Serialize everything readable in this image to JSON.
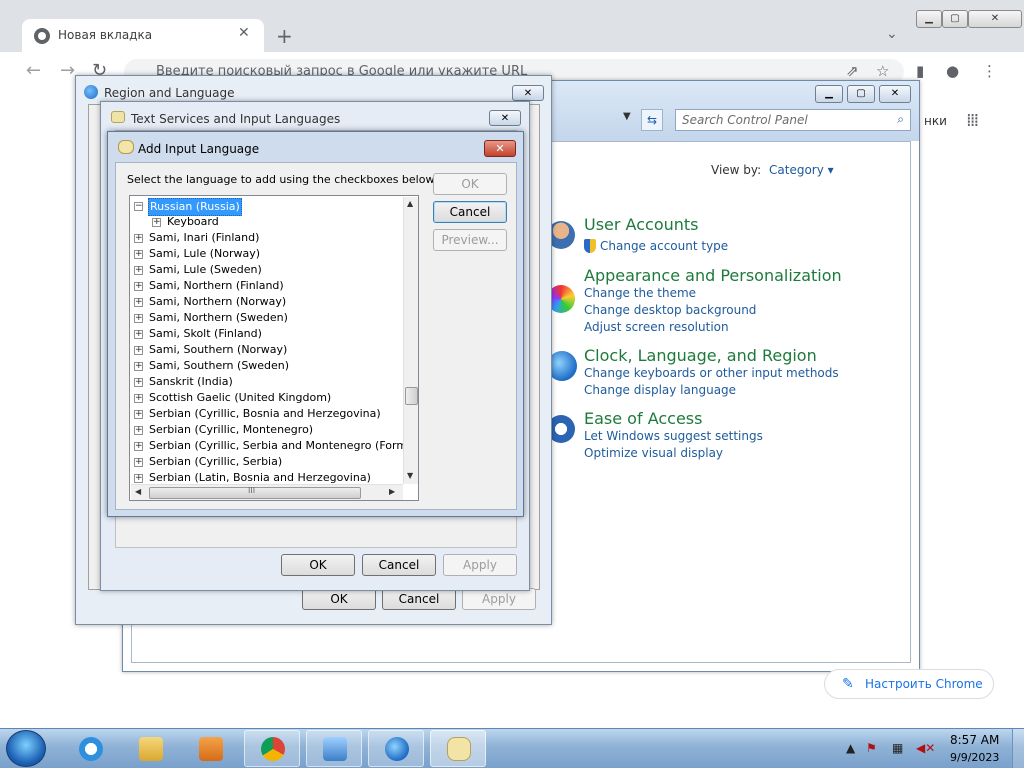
{
  "chrome": {
    "tab_title": "Новая вкладка",
    "omnibox_placeholder": "Введите поисковый запрос в Google или укажите URL",
    "customize_label": "Настроить Chrome",
    "partial_text": "нки"
  },
  "control_panel": {
    "search_placeholder": "Search Control Panel",
    "view_by_label": "View by:",
    "view_by_value": "Category",
    "categories": [
      {
        "title": "User Accounts",
        "links": [
          "Change account type"
        ]
      },
      {
        "title": "Appearance and Personalization",
        "links": [
          "Change the theme",
          "Change desktop background",
          "Adjust screen resolution"
        ]
      },
      {
        "title": "Clock, Language, and Region",
        "links": [
          "Change keyboards or other input methods",
          "Change display language"
        ]
      },
      {
        "title": "Ease of Access",
        "links": [
          "Let Windows suggest settings",
          "Optimize visual display"
        ]
      }
    ]
  },
  "region_language": {
    "title": "Region and Language",
    "buttons": {
      "ok": "OK",
      "cancel": "Cancel",
      "apply": "Apply"
    }
  },
  "text_services": {
    "title": "Text Services and Input Languages",
    "buttons": {
      "ok": "OK",
      "cancel": "Cancel",
      "apply": "Apply"
    }
  },
  "add_input_language": {
    "title": "Add Input Language",
    "instruction": "Select the language to add using the checkboxes below.",
    "buttons": {
      "ok": "OK",
      "cancel": "Cancel",
      "preview": "Preview..."
    },
    "tree": [
      {
        "label": "Russian (Russia)",
        "level": 0,
        "expanded": true,
        "selected": true
      },
      {
        "label": "Keyboard",
        "level": 1,
        "expanded": false
      },
      {
        "label": "Sami, Inari (Finland)",
        "level": 0
      },
      {
        "label": "Sami, Lule (Norway)",
        "level": 0
      },
      {
        "label": "Sami, Lule (Sweden)",
        "level": 0
      },
      {
        "label": "Sami, Northern (Finland)",
        "level": 0
      },
      {
        "label": "Sami, Northern (Norway)",
        "level": 0
      },
      {
        "label": "Sami, Northern (Sweden)",
        "level": 0
      },
      {
        "label": "Sami, Skolt (Finland)",
        "level": 0
      },
      {
        "label": "Sami, Southern (Norway)",
        "level": 0
      },
      {
        "label": "Sami, Southern (Sweden)",
        "level": 0
      },
      {
        "label": "Sanskrit (India)",
        "level": 0
      },
      {
        "label": "Scottish Gaelic (United Kingdom)",
        "level": 0
      },
      {
        "label": "Serbian (Cyrillic, Bosnia and Herzegovina)",
        "level": 0
      },
      {
        "label": "Serbian (Cyrillic, Montenegro)",
        "level": 0
      },
      {
        "label": "Serbian (Cyrillic, Serbia and Montenegro (Former))",
        "level": 0
      },
      {
        "label": "Serbian (Cyrillic, Serbia)",
        "level": 0
      },
      {
        "label": "Serbian (Latin, Bosnia and Herzegovina)",
        "level": 0
      }
    ],
    "hscroll_marker": "III"
  },
  "taskbar": {
    "time": "8:57 AM",
    "date": "9/9/2023"
  }
}
